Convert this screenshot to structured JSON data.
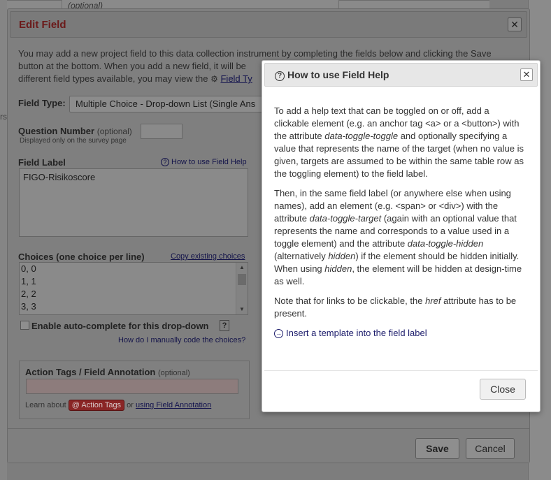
{
  "background": {
    "top_fragment": "(optional)",
    "side_fragment": "rs"
  },
  "edit_field": {
    "title": "Edit Field",
    "intro_line1": "You may add a new project field to this data collection instrument by completing the fields below and clicking the Save",
    "intro_line2": "button at the bottom. When you add a new field, it will be",
    "intro_line3": "different field types available, you may view the",
    "field_types_link": "Field Ty",
    "field_type_label": "Field Type:",
    "field_type_value": "Multiple Choice - Drop-down List (Single Ans",
    "question_number_label": "Question Number",
    "question_number_optional": "(optional)",
    "question_number_note": "Displayed only on the survey page",
    "field_label_label": "Field Label",
    "how_to_use_help_link": "How to use Field Help",
    "field_label_value": "FIGO-Risikoscore",
    "choices_label": "Choices (one choice per line)",
    "copy_choices_link": "Copy existing choices",
    "choices": [
      "0, 0",
      "1, 1",
      "2, 2",
      "3, 3"
    ],
    "autocomplete_label": "Enable auto-complete for this drop-down",
    "autocomplete_help": "?",
    "manual_code_link": "How do I manually code the choices?",
    "action_tags_label": "Action Tags / Field Annotation",
    "action_tags_optional": "(optional)",
    "learn_about": "Learn about",
    "action_tags_button": "@ Action Tags",
    "or_text": "or",
    "field_annotation_link": "using Field Annotation",
    "save_button": "Save",
    "cancel_button": "Cancel"
  },
  "help_modal": {
    "title": "How to use Field Help",
    "p1_a": "To add a help text that can be toggled on or off, add a clickable element (e.g. an anchor tag <a> or a <button>) with the attribute ",
    "p1_attr": "data-toggle-toggle",
    "p1_b": " and optionally specifying a value that represents the name of the target (when no value is given, targets are assumed to be within the same table row as the toggling element) to the field label.",
    "p2_a": "Then, in the same field label (or anywhere else when using names), add an element (e.g. <span> or <div>) with the attribute ",
    "p2_attr1": "data-toggle-target",
    "p2_b": " (again with an optional value that represents the name and corresponds to a value used in a toggle element) and the attribute ",
    "p2_attr2": "data-toggle-hidden",
    "p2_c": " (alternatively ",
    "p2_attr3": "hidden",
    "p2_d": ") if the element should be hidden initially. When using ",
    "p2_attr4": "hidden",
    "p2_e": ", the element will be hidden at design-time as well.",
    "p3_a": "Note that for links to be clickable, the ",
    "p3_attr": "href",
    "p3_b": " attribute has to be present.",
    "insert_link": "Insert a template into the field label",
    "close_button": "Close"
  }
}
